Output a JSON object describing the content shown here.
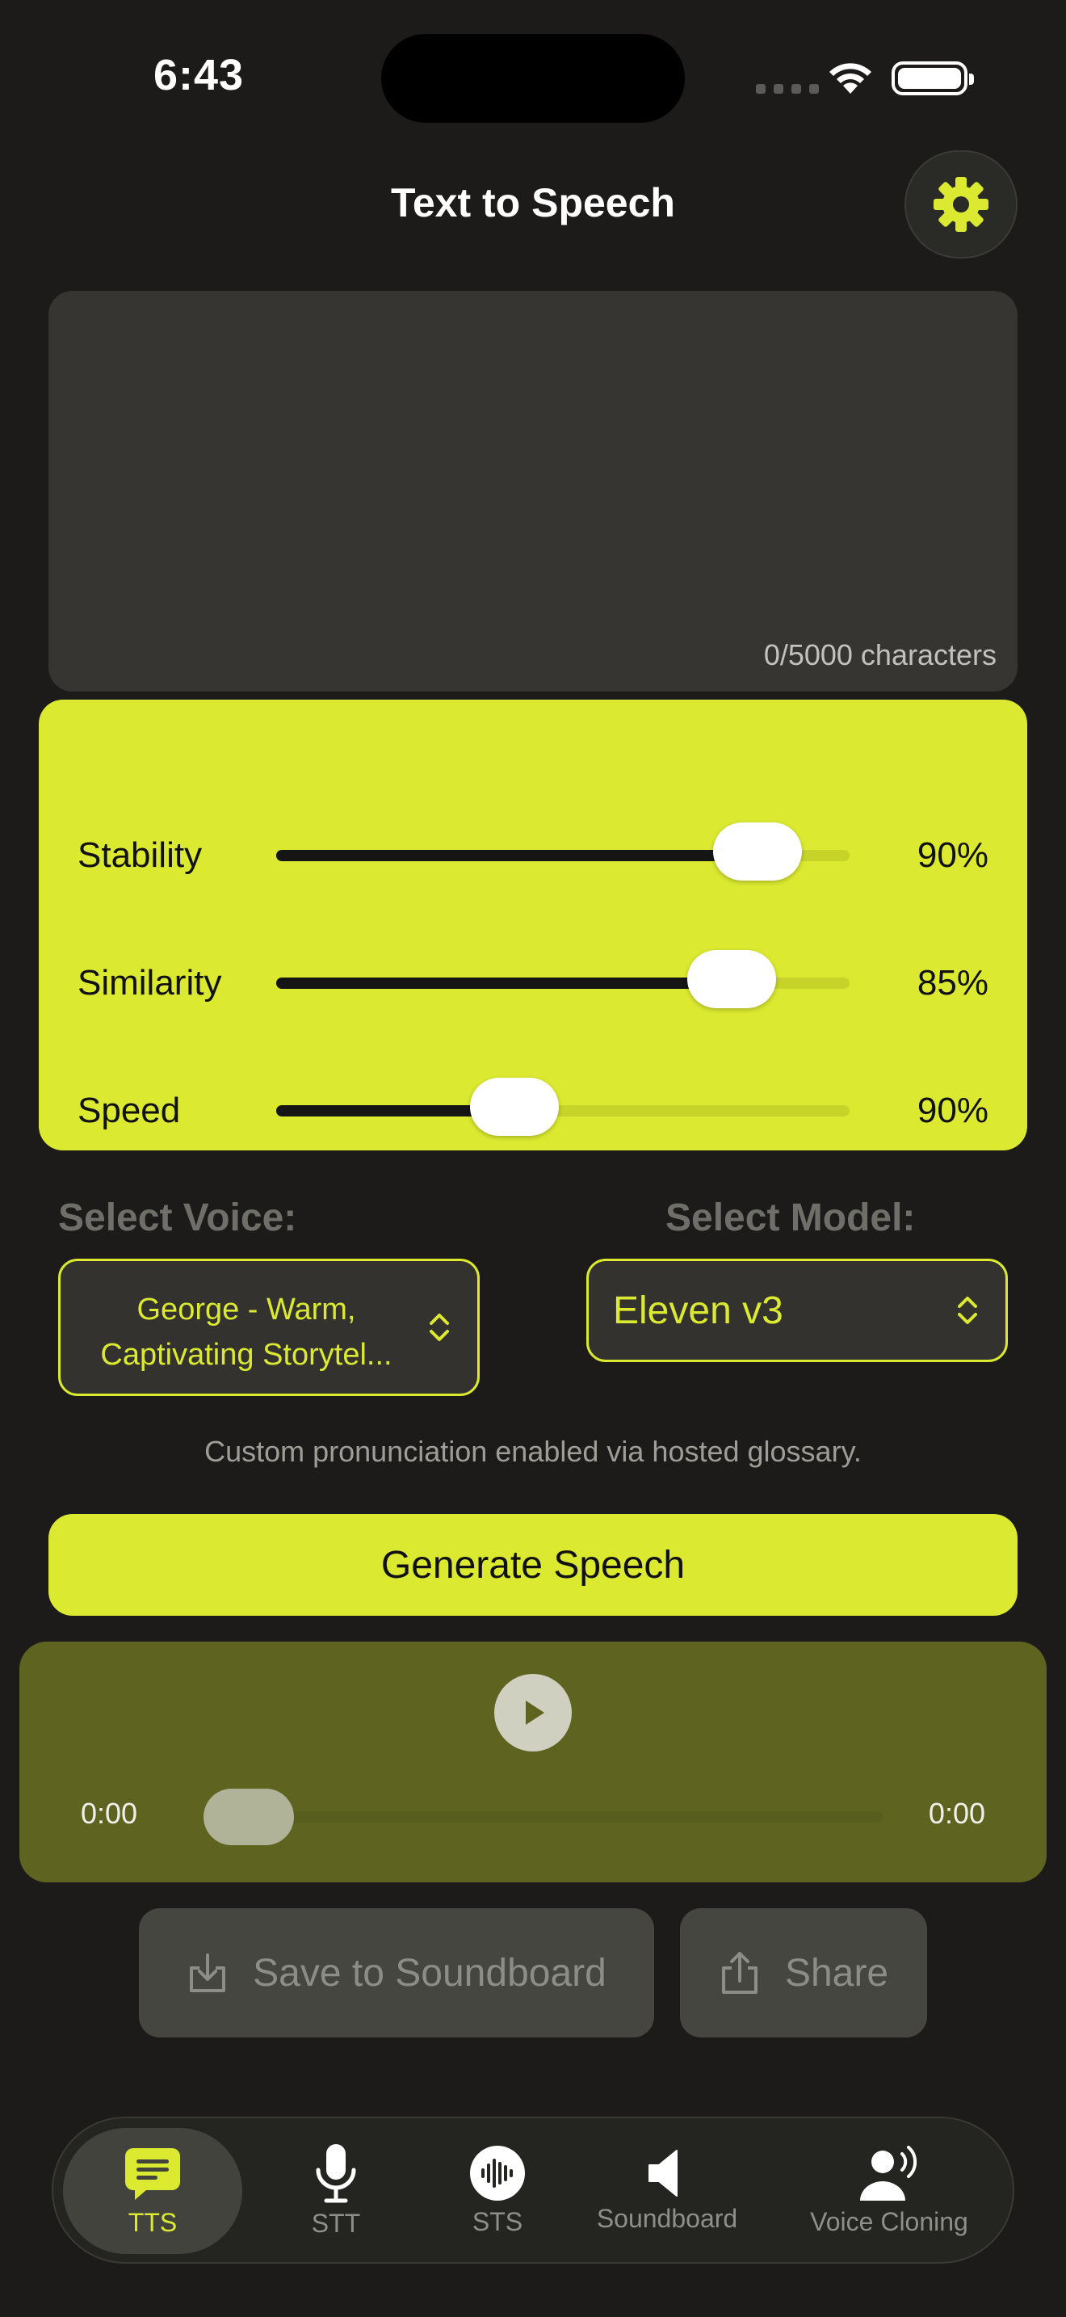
{
  "status": {
    "time": "6:43"
  },
  "header": {
    "title": "Text to Speech"
  },
  "text_input": {
    "value": "",
    "char_count": "0/5000 characters"
  },
  "sliders": [
    {
      "label": "Stability",
      "value": 0.84,
      "display": "90%"
    },
    {
      "label": "Similarity",
      "value": 0.795,
      "display": "85%"
    },
    {
      "label": "Speed",
      "value": 0.415,
      "display": "90%"
    }
  ],
  "voice": {
    "label": "Select Voice:",
    "line1": "George - Warm,",
    "line2": "Captivating Storytel..."
  },
  "model": {
    "label": "Select Model:",
    "value": "Eleven v3"
  },
  "note": "Custom pronunciation enabled via hosted glossary.",
  "generate": {
    "label": "Generate Speech"
  },
  "player": {
    "current": "0:00",
    "duration": "0:00",
    "progress": 0
  },
  "actions": {
    "save": "Save to Soundboard",
    "share": "Share"
  },
  "tabs": [
    {
      "label": "TTS",
      "icon": "message-icon",
      "active": true
    },
    {
      "label": "STT",
      "icon": "microphone-icon",
      "active": false
    },
    {
      "label": "STS",
      "icon": "waveform-icon",
      "active": false
    },
    {
      "label": "Soundboard",
      "icon": "speaker-icon",
      "active": false
    },
    {
      "label": "Voice Cloning",
      "icon": "person-wave-icon",
      "active": false
    }
  ],
  "colors": {
    "accent": "#dbea30",
    "background": "#1c1b19",
    "player": "#5e6420"
  }
}
